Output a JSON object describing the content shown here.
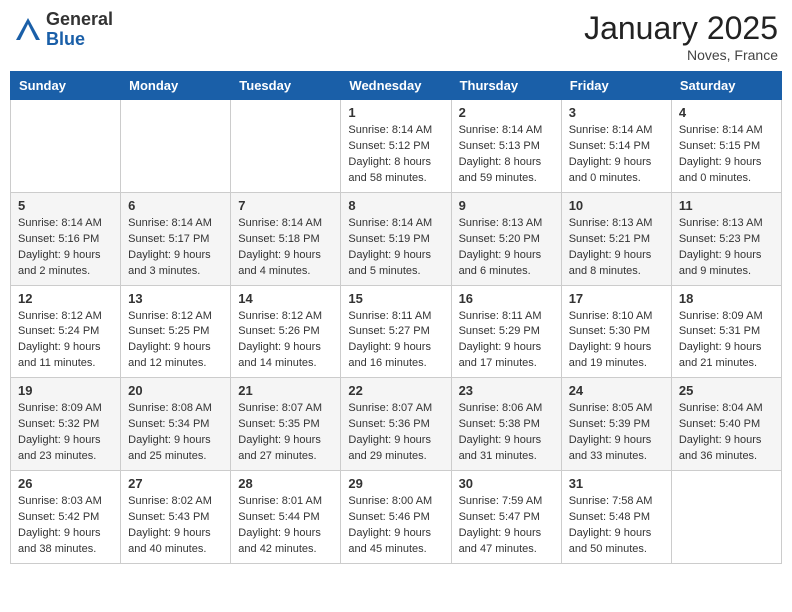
{
  "header": {
    "logo_general": "General",
    "logo_blue": "Blue",
    "month_title": "January 2025",
    "location": "Noves, France"
  },
  "days_of_week": [
    "Sunday",
    "Monday",
    "Tuesday",
    "Wednesday",
    "Thursday",
    "Friday",
    "Saturday"
  ],
  "weeks": [
    [
      {
        "day": "",
        "info": ""
      },
      {
        "day": "",
        "info": ""
      },
      {
        "day": "",
        "info": ""
      },
      {
        "day": "1",
        "info": "Sunrise: 8:14 AM\nSunset: 5:12 PM\nDaylight: 8 hours\nand 58 minutes."
      },
      {
        "day": "2",
        "info": "Sunrise: 8:14 AM\nSunset: 5:13 PM\nDaylight: 8 hours\nand 59 minutes."
      },
      {
        "day": "3",
        "info": "Sunrise: 8:14 AM\nSunset: 5:14 PM\nDaylight: 9 hours\nand 0 minutes."
      },
      {
        "day": "4",
        "info": "Sunrise: 8:14 AM\nSunset: 5:15 PM\nDaylight: 9 hours\nand 0 minutes."
      }
    ],
    [
      {
        "day": "5",
        "info": "Sunrise: 8:14 AM\nSunset: 5:16 PM\nDaylight: 9 hours\nand 2 minutes."
      },
      {
        "day": "6",
        "info": "Sunrise: 8:14 AM\nSunset: 5:17 PM\nDaylight: 9 hours\nand 3 minutes."
      },
      {
        "day": "7",
        "info": "Sunrise: 8:14 AM\nSunset: 5:18 PM\nDaylight: 9 hours\nand 4 minutes."
      },
      {
        "day": "8",
        "info": "Sunrise: 8:14 AM\nSunset: 5:19 PM\nDaylight: 9 hours\nand 5 minutes."
      },
      {
        "day": "9",
        "info": "Sunrise: 8:13 AM\nSunset: 5:20 PM\nDaylight: 9 hours\nand 6 minutes."
      },
      {
        "day": "10",
        "info": "Sunrise: 8:13 AM\nSunset: 5:21 PM\nDaylight: 9 hours\nand 8 minutes."
      },
      {
        "day": "11",
        "info": "Sunrise: 8:13 AM\nSunset: 5:23 PM\nDaylight: 9 hours\nand 9 minutes."
      }
    ],
    [
      {
        "day": "12",
        "info": "Sunrise: 8:12 AM\nSunset: 5:24 PM\nDaylight: 9 hours\nand 11 minutes."
      },
      {
        "day": "13",
        "info": "Sunrise: 8:12 AM\nSunset: 5:25 PM\nDaylight: 9 hours\nand 12 minutes."
      },
      {
        "day": "14",
        "info": "Sunrise: 8:12 AM\nSunset: 5:26 PM\nDaylight: 9 hours\nand 14 minutes."
      },
      {
        "day": "15",
        "info": "Sunrise: 8:11 AM\nSunset: 5:27 PM\nDaylight: 9 hours\nand 16 minutes."
      },
      {
        "day": "16",
        "info": "Sunrise: 8:11 AM\nSunset: 5:29 PM\nDaylight: 9 hours\nand 17 minutes."
      },
      {
        "day": "17",
        "info": "Sunrise: 8:10 AM\nSunset: 5:30 PM\nDaylight: 9 hours\nand 19 minutes."
      },
      {
        "day": "18",
        "info": "Sunrise: 8:09 AM\nSunset: 5:31 PM\nDaylight: 9 hours\nand 21 minutes."
      }
    ],
    [
      {
        "day": "19",
        "info": "Sunrise: 8:09 AM\nSunset: 5:32 PM\nDaylight: 9 hours\nand 23 minutes."
      },
      {
        "day": "20",
        "info": "Sunrise: 8:08 AM\nSunset: 5:34 PM\nDaylight: 9 hours\nand 25 minutes."
      },
      {
        "day": "21",
        "info": "Sunrise: 8:07 AM\nSunset: 5:35 PM\nDaylight: 9 hours\nand 27 minutes."
      },
      {
        "day": "22",
        "info": "Sunrise: 8:07 AM\nSunset: 5:36 PM\nDaylight: 9 hours\nand 29 minutes."
      },
      {
        "day": "23",
        "info": "Sunrise: 8:06 AM\nSunset: 5:38 PM\nDaylight: 9 hours\nand 31 minutes."
      },
      {
        "day": "24",
        "info": "Sunrise: 8:05 AM\nSunset: 5:39 PM\nDaylight: 9 hours\nand 33 minutes."
      },
      {
        "day": "25",
        "info": "Sunrise: 8:04 AM\nSunset: 5:40 PM\nDaylight: 9 hours\nand 36 minutes."
      }
    ],
    [
      {
        "day": "26",
        "info": "Sunrise: 8:03 AM\nSunset: 5:42 PM\nDaylight: 9 hours\nand 38 minutes."
      },
      {
        "day": "27",
        "info": "Sunrise: 8:02 AM\nSunset: 5:43 PM\nDaylight: 9 hours\nand 40 minutes."
      },
      {
        "day": "28",
        "info": "Sunrise: 8:01 AM\nSunset: 5:44 PM\nDaylight: 9 hours\nand 42 minutes."
      },
      {
        "day": "29",
        "info": "Sunrise: 8:00 AM\nSunset: 5:46 PM\nDaylight: 9 hours\nand 45 minutes."
      },
      {
        "day": "30",
        "info": "Sunrise: 7:59 AM\nSunset: 5:47 PM\nDaylight: 9 hours\nand 47 minutes."
      },
      {
        "day": "31",
        "info": "Sunrise: 7:58 AM\nSunset: 5:48 PM\nDaylight: 9 hours\nand 50 minutes."
      },
      {
        "day": "",
        "info": ""
      }
    ]
  ]
}
